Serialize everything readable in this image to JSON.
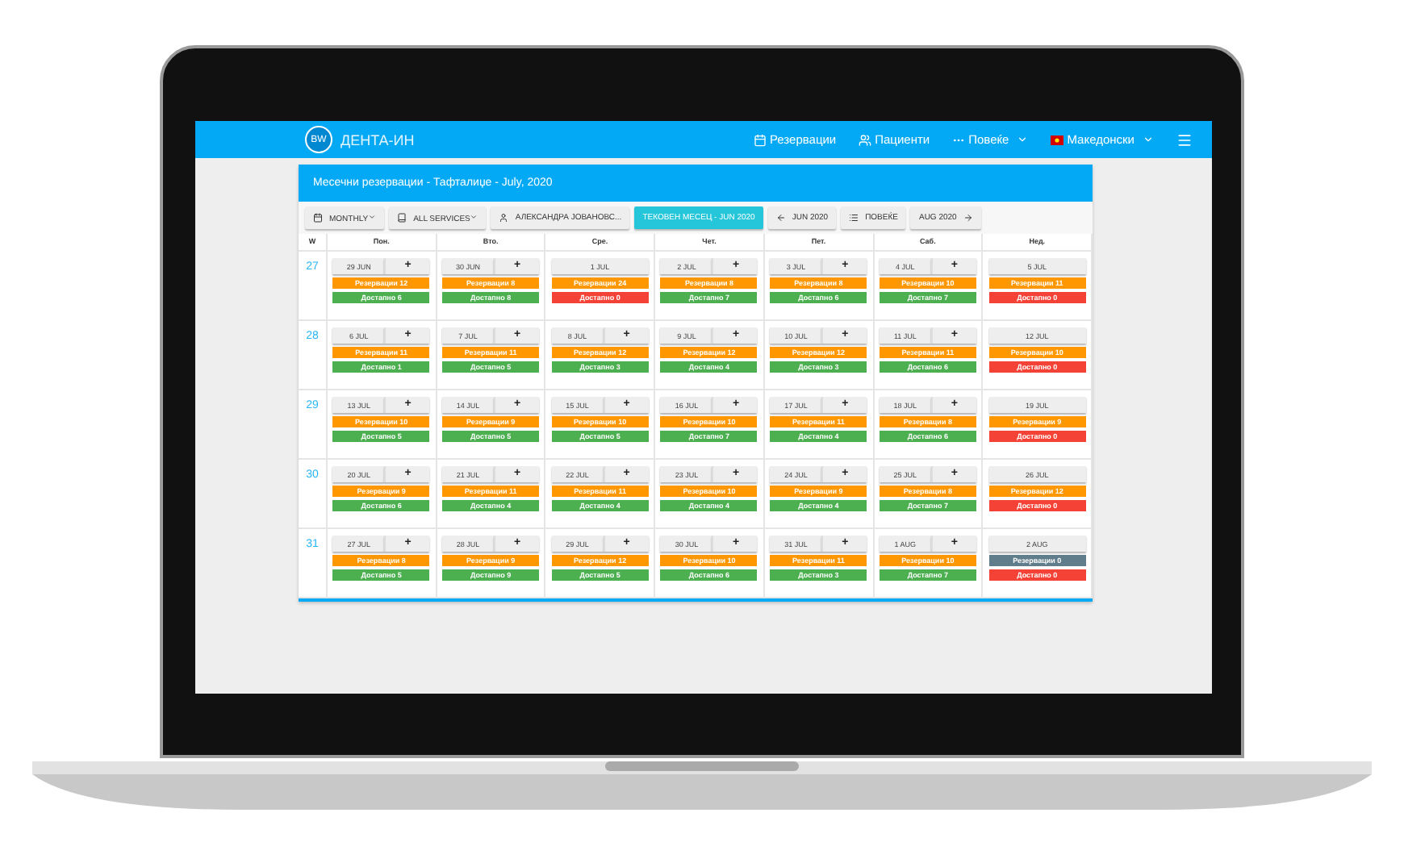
{
  "navbar": {
    "logo": "BW",
    "brand": "ДЕНТА-ИН",
    "items": [
      {
        "label": "Резервации",
        "kind": "calendar"
      },
      {
        "label": "Пациенти",
        "kind": "users"
      },
      {
        "label": "Повеќе",
        "kind": "more"
      },
      {
        "label": "Македонски",
        "kind": "language"
      }
    ]
  },
  "card": {
    "title": "Месечни резервации - Тафталиџе - July, 2020",
    "toolbar": [
      {
        "label": "MONTHLY",
        "kind": "dropdown"
      },
      {
        "label": "ALL SERVICES",
        "kind": "dropdown"
      },
      {
        "label": "АЛЕКСАНДРА ЈОВАНОВС...",
        "kind": "plain"
      },
      {
        "label": "ТЕКОВЕН МЕСЕЦ - JUN 2020",
        "kind": "primary"
      },
      {
        "label": "JUN 2020",
        "kind": "prev"
      },
      {
        "label": "ПОВЕЌЕ",
        "kind": "plain"
      },
      {
        "label": "AUG 2020",
        "kind": "next"
      }
    ],
    "columns": [
      "W",
      "Пон.",
      "Вто.",
      "Сре.",
      "Чет.",
      "Пет.",
      "Саб.",
      "Нед."
    ],
    "weeks": [
      {
        "week": "27",
        "days": [
          {
            "date": "29 JUN",
            "add": "+",
            "reserved": {
              "text": "Резервации 12",
              "color": "#ff9800"
            },
            "available": {
              "text": "Достапно 6",
              "color": "#4caf50"
            }
          },
          {
            "date": "30 JUN",
            "add": "+",
            "reserved": {
              "text": "Резервации 8",
              "color": "#ff9800"
            },
            "available": {
              "text": "Достапно 8",
              "color": "#4caf50"
            }
          },
          {
            "date": "1 JUL",
            "reserved": {
              "text": "Резервации 24",
              "color": "#ff9800"
            },
            "available": {
              "text": "Достапно 0",
              "color": "#f44336"
            }
          },
          {
            "date": "2 JUL",
            "add": "+",
            "reserved": {
              "text": "Резервации 8",
              "color": "#ff9800"
            },
            "available": {
              "text": "Достапно 7",
              "color": "#4caf50"
            }
          },
          {
            "date": "3 JUL",
            "add": "+",
            "reserved": {
              "text": "Резервации 8",
              "color": "#ff9800"
            },
            "available": {
              "text": "Достапно 6",
              "color": "#4caf50"
            }
          },
          {
            "date": "4 JUL",
            "add": "+",
            "reserved": {
              "text": "Резервации 10",
              "color": "#ff9800"
            },
            "available": {
              "text": "Достапно 7",
              "color": "#4caf50"
            }
          },
          {
            "date": "5 JUL",
            "reserved": {
              "text": "Резервации 11",
              "color": "#ff9800"
            },
            "available": {
              "text": "Достапно 0",
              "color": "#f44336"
            }
          }
        ]
      },
      {
        "week": "28",
        "days": [
          {
            "date": "6 JUL",
            "add": "+",
            "reserved": {
              "text": "Резервации 11",
              "color": "#ff9800"
            },
            "available": {
              "text": "Достапно 1",
              "color": "#4caf50"
            }
          },
          {
            "date": "7 JUL",
            "add": "+",
            "reserved": {
              "text": "Резервации 11",
              "color": "#ff9800"
            },
            "available": {
              "text": "Достапно 5",
              "color": "#4caf50"
            }
          },
          {
            "date": "8 JUL",
            "add": "+",
            "reserved": {
              "text": "Резервации 12",
              "color": "#ff9800"
            },
            "available": {
              "text": "Достапно 3",
              "color": "#4caf50"
            }
          },
          {
            "date": "9 JUL",
            "add": "+",
            "reserved": {
              "text": "Резервации 12",
              "color": "#ff9800"
            },
            "available": {
              "text": "Достапно 4",
              "color": "#4caf50"
            }
          },
          {
            "date": "10 JUL",
            "add": "+",
            "reserved": {
              "text": "Резервации 12",
              "color": "#ff9800"
            },
            "available": {
              "text": "Достапно 3",
              "color": "#4caf50"
            }
          },
          {
            "date": "11 JUL",
            "add": "+",
            "reserved": {
              "text": "Резервации 11",
              "color": "#ff9800"
            },
            "available": {
              "text": "Достапно 6",
              "color": "#4caf50"
            }
          },
          {
            "date": "12 JUL",
            "reserved": {
              "text": "Резервации 10",
              "color": "#ff9800"
            },
            "available": {
              "text": "Достапно 0",
              "color": "#f44336"
            }
          }
        ]
      },
      {
        "week": "29",
        "days": [
          {
            "date": "13 JUL",
            "add": "+",
            "reserved": {
              "text": "Резервации 10",
              "color": "#ff9800"
            },
            "available": {
              "text": "Достапно 5",
              "color": "#4caf50"
            }
          },
          {
            "date": "14 JUL",
            "add": "+",
            "reserved": {
              "text": "Резервации 9",
              "color": "#ff9800"
            },
            "available": {
              "text": "Достапно 5",
              "color": "#4caf50"
            }
          },
          {
            "date": "15 JUL",
            "add": "+",
            "reserved": {
              "text": "Резервации 10",
              "color": "#ff9800"
            },
            "available": {
              "text": "Достапно 5",
              "color": "#4caf50"
            }
          },
          {
            "date": "16 JUL",
            "add": "+",
            "reserved": {
              "text": "Резервации 10",
              "color": "#ff9800"
            },
            "available": {
              "text": "Достапно 7",
              "color": "#4caf50"
            }
          },
          {
            "date": "17 JUL",
            "add": "+",
            "reserved": {
              "text": "Резервации 11",
              "color": "#ff9800"
            },
            "available": {
              "text": "Достапно 4",
              "color": "#4caf50"
            }
          },
          {
            "date": "18 JUL",
            "add": "+",
            "reserved": {
              "text": "Резервации 8",
              "color": "#ff9800"
            },
            "available": {
              "text": "Достапно 6",
              "color": "#4caf50"
            }
          },
          {
            "date": "19 JUL",
            "reserved": {
              "text": "Резервации 9",
              "color": "#ff9800"
            },
            "available": {
              "text": "Достапно 0",
              "color": "#f44336"
            }
          }
        ]
      },
      {
        "week": "30",
        "days": [
          {
            "date": "20 JUL",
            "add": "+",
            "reserved": {
              "text": "Резервации 9",
              "color": "#ff9800"
            },
            "available": {
              "text": "Достапно 6",
              "color": "#4caf50"
            }
          },
          {
            "date": "21 JUL",
            "add": "+",
            "reserved": {
              "text": "Резервации 11",
              "color": "#ff9800"
            },
            "available": {
              "text": "Достапно 4",
              "color": "#4caf50"
            }
          },
          {
            "date": "22 JUL",
            "add": "+",
            "reserved": {
              "text": "Резервации 11",
              "color": "#ff9800"
            },
            "available": {
              "text": "Достапно 4",
              "color": "#4caf50"
            }
          },
          {
            "date": "23 JUL",
            "add": "+",
            "reserved": {
              "text": "Резервации 10",
              "color": "#ff9800"
            },
            "available": {
              "text": "Достапно 4",
              "color": "#4caf50"
            }
          },
          {
            "date": "24 JUL",
            "add": "+",
            "reserved": {
              "text": "Резервации 9",
              "color": "#ff9800"
            },
            "available": {
              "text": "Достапно 4",
              "color": "#4caf50"
            }
          },
          {
            "date": "25 JUL",
            "add": "+",
            "reserved": {
              "text": "Резервации 8",
              "color": "#ff9800"
            },
            "available": {
              "text": "Достапно 7",
              "color": "#4caf50"
            }
          },
          {
            "date": "26 JUL",
            "reserved": {
              "text": "Резервации 12",
              "color": "#ff9800"
            },
            "available": {
              "text": "Достапно 0",
              "color": "#f44336"
            }
          }
        ]
      },
      {
        "week": "31",
        "days": [
          {
            "date": "27 JUL",
            "add": "+",
            "reserved": {
              "text": "Резервации 8",
              "color": "#ff9800"
            },
            "available": {
              "text": "Достапно 5",
              "color": "#4caf50"
            }
          },
          {
            "date": "28 JUL",
            "add": "+",
            "reserved": {
              "text": "Резервации 9",
              "color": "#ff9800"
            },
            "available": {
              "text": "Достапно 9",
              "color": "#4caf50"
            }
          },
          {
            "date": "29 JUL",
            "add": "+",
            "reserved": {
              "text": "Резервации 12",
              "color": "#ff9800"
            },
            "available": {
              "text": "Достапно 5",
              "color": "#4caf50"
            }
          },
          {
            "date": "30 JUL",
            "add": "+",
            "reserved": {
              "text": "Резервации 10",
              "color": "#ff9800"
            },
            "available": {
              "text": "Достапно 6",
              "color": "#4caf50"
            }
          },
          {
            "date": "31 JUL",
            "add": "+",
            "reserved": {
              "text": "Резервации 11",
              "color": "#ff9800"
            },
            "available": {
              "text": "Достапно 3",
              "color": "#4caf50"
            }
          },
          {
            "date": "1 AUG",
            "add": "+",
            "reserved": {
              "text": "Резервации 10",
              "color": "#ff9800"
            },
            "available": {
              "text": "Достапно 7",
              "color": "#4caf50"
            }
          },
          {
            "date": "2 AUG",
            "reserved": {
              "text": "Резервации 0",
              "color": "#607d8b"
            },
            "available": {
              "text": "Достапно 0",
              "color": "#f44336"
            }
          }
        ]
      }
    ]
  }
}
